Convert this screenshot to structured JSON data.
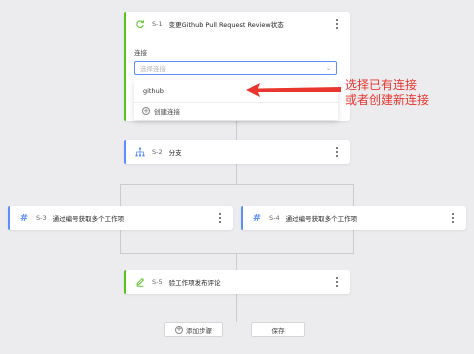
{
  "steps": [
    {
      "id": "S-1",
      "title": "变更Github Pull Request Review状态",
      "icon": "sync-icon",
      "accent": "#52c41a",
      "icon_color": "#52c41a"
    },
    {
      "id": "S-2",
      "title": "分支",
      "icon": "branch-icon",
      "accent": "#5b8ff9",
      "icon_color": "#5b8ff9"
    },
    {
      "id": "S-3",
      "title": "通过编号获取多个工作项",
      "icon": "hash-icon",
      "accent": "#5b8ff9",
      "icon_color": "#5b8ff9"
    },
    {
      "id": "S-4",
      "title": "通过编号获取多个工作项",
      "icon": "hash-icon",
      "accent": "#5b8ff9",
      "icon_color": "#5b8ff9"
    },
    {
      "id": "S-5",
      "title": "验工作项发布评论",
      "icon": "edit-icon",
      "accent": "#52c41a",
      "icon_color": "#52c41a"
    }
  ],
  "connection": {
    "label": "连接",
    "placeholder": "选择连接",
    "options": [
      "github"
    ],
    "create_label": "创建连接"
  },
  "annotation": {
    "line1": "选择已有连接",
    "line2": "或者创建新连接",
    "color": "#e8352e"
  },
  "footer": {
    "add_step_label": "添加步骤",
    "save_label": "保存"
  }
}
